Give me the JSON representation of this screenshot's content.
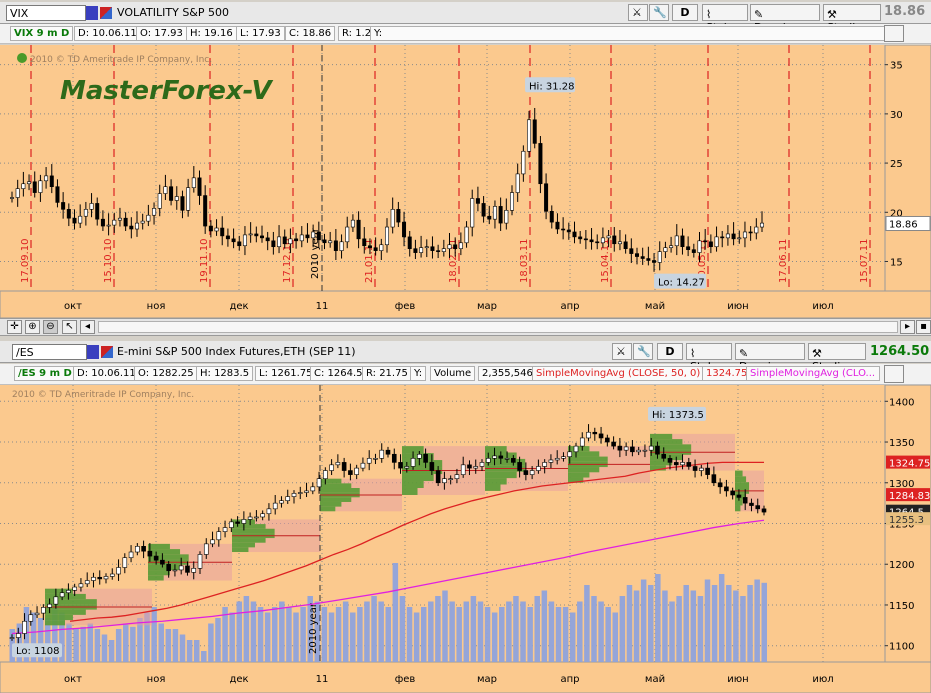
{
  "colors": {
    "bg": "#fbc98e",
    "up": "#000000",
    "grid": "#8a8a8a",
    "vline": "#dd2222",
    "ma50": "#dd2222",
    "ma200": "#e020e0",
    "volume": "#8fa3dc",
    "vp_green": "#4f9a2f",
    "vp_pink": "#e8a0a0",
    "price_last_green": "#0a7a0a"
  },
  "top": {
    "symbol": "VIX",
    "title": "VOLATILITY S&P 500",
    "last": "18.86",
    "buttons": {
      "d": "D",
      "style": "Style",
      "drawings": "Drawings",
      "studies": "Studies"
    },
    "info": {
      "period": "VIX 9 m D",
      "date": "D: 10.06.11",
      "open": "O: 17.93",
      "high": "H: 19.16",
      "low": "L: 17.93",
      "close": "C: 18.86",
      "range": "R: 1.23",
      "y": "Y:"
    },
    "copyright": "2010 © TD Ameritrade IP Company, Inc.",
    "watermark": "MasterForex-V",
    "hi_label": "Hi: 31.28",
    "lo_label": "Lo: 14.27",
    "date_labels": [
      "17.09.10",
      "15.10.10",
      "19.11.10",
      "17.12.10",
      "21.01.11",
      "18.02.11",
      "18.03.11",
      "15.04.11",
      "20.05.11",
      "17.06.11",
      "15.07.11"
    ],
    "year_label": "2010 year",
    "y_ticks": [
      "35",
      "30",
      "25",
      "20",
      "15"
    ],
    "last_label": "18.86"
  },
  "bottom": {
    "symbol": "/ES",
    "title": "E-mini S&P 500 Index Futures,ETH (SEP 11)",
    "last": "1264.50",
    "buttons": {
      "d": "D",
      "style": "Style",
      "drawings": "Drawings",
      "studies": "Studies"
    },
    "info": {
      "period": "/ES 9 m D",
      "date": "D: 10.06.11",
      "open": "O: 1282.25",
      "high": "H: 1283.5",
      "low": "L: 1261.75",
      "close": "C: 1264.5",
      "range": "R: 21.75",
      "y": "Y:",
      "volume_label": "Volume",
      "volume": "2,355,546",
      "sma50_label": "SimpleMovingAvg (CLOSE, 50, 0)",
      "sma50_value": "1324.75",
      "sma200_label": "SimpleMovingAvg (CLO..."
    },
    "copyright": "2010 © TD Ameritrade IP Company, Inc.",
    "hi_label": "Hi: 1373.5",
    "lo_label": "Lo: 1108",
    "year_label": "2010 year",
    "y_ticks": [
      "1400",
      "1350",
      "1300",
      "1250",
      "1200",
      "1150",
      "1100"
    ],
    "price_tags": [
      "1324.75",
      "1284.83",
      "1264.5",
      "1255.3"
    ]
  },
  "months": [
    "окт",
    "ноя",
    "дек",
    "11",
    "фев",
    "мар",
    "апр",
    "май",
    "июн",
    "июл"
  ],
  "chart_data": [
    {
      "type": "line",
      "title": "VOLATILITY S&P 500",
      "ylim": [
        12,
        37
      ],
      "grid": true,
      "series": [
        {
          "name": "VIX",
          "values": [
            21.5,
            22.4,
            22.9,
            23.1,
            22.0,
            23.2,
            23.7,
            22.6,
            21.0,
            20.3,
            19.4,
            18.9,
            19.6,
            20.3,
            20.9,
            19.3,
            18.6,
            18.7,
            19.2,
            19.4,
            18.6,
            18.3,
            18.9,
            19.1,
            19.7,
            20.4,
            21.9,
            22.6,
            21.2,
            21.6,
            20.2,
            22.5,
            23.5,
            21.7,
            18.6,
            18.1,
            18.4,
            17.6,
            17.3,
            17.0,
            16.6,
            17.7,
            17.8,
            17.6,
            17.4,
            17.1,
            16.5,
            17.5,
            16.8,
            17.3,
            17.1,
            17.7,
            17.4,
            18.0,
            17.2,
            16.9,
            17.1,
            16.1,
            17.0,
            18.5,
            19.2,
            17.3,
            16.6,
            16.4,
            16.1,
            16.7,
            18.5,
            20.3,
            19.0,
            17.5,
            16.3,
            15.9,
            16.4,
            16.5,
            16.1,
            16.0,
            16.3,
            16.7,
            16.3,
            16.9,
            18.5,
            21.4,
            20.9,
            19.6,
            19.3,
            20.6,
            18.9,
            20.2,
            22.0,
            23.9,
            26.2,
            29.4,
            27.0,
            22.9,
            20.1,
            19.0,
            18.3,
            18.2,
            18.0,
            17.5,
            17.3,
            17.2,
            17.0,
            16.9,
            17.4,
            17.6,
            16.8,
            17.0,
            16.3,
            15.8,
            15.5,
            15.3,
            15.1,
            14.9,
            16.0,
            16.4,
            16.6,
            17.6,
            16.5,
            16.2,
            15.9,
            17.1,
            17.0,
            16.5,
            17.5,
            17.4,
            17.8,
            17.3,
            17.4,
            18.0,
            17.9,
            18.5,
            18.9
          ]
        }
      ]
    },
    {
      "type": "line",
      "title": "E-mini S&P 500 Index Futures,ETH (SEP 11)",
      "ylim": [
        1080,
        1420
      ],
      "grid": true,
      "series": [
        {
          "name": "/ES",
          "values": [
            1110,
            1115,
            1130,
            1138,
            1140,
            1147,
            1151,
            1160,
            1165,
            1168,
            1172,
            1176,
            1180,
            1184,
            1182,
            1185,
            1188,
            1196,
            1208,
            1215,
            1222,
            1216,
            1210,
            1205,
            1200,
            1192,
            1193,
            1198,
            1190,
            1195,
            1212,
            1225,
            1230,
            1240,
            1245,
            1252,
            1250,
            1255,
            1258,
            1258,
            1262,
            1268,
            1275,
            1278,
            1283,
            1287,
            1288,
            1290,
            1295,
            1305,
            1315,
            1322,
            1325,
            1315,
            1310,
            1318,
            1324,
            1330,
            1330,
            1340,
            1335,
            1325,
            1318,
            1320,
            1330,
            1335,
            1325,
            1315,
            1300,
            1305,
            1305,
            1310,
            1322,
            1318,
            1320,
            1325,
            1330,
            1333,
            1330,
            1330,
            1325,
            1315,
            1310,
            1315,
            1320,
            1325,
            1328,
            1330,
            1332,
            1338,
            1345,
            1355,
            1362,
            1360,
            1355,
            1350,
            1345,
            1340,
            1344,
            1338,
            1340,
            1340,
            1345,
            1335,
            1330,
            1325,
            1322,
            1325,
            1320,
            1315,
            1318,
            1310,
            1300,
            1295,
            1290,
            1285,
            1282,
            1275,
            1272,
            1268,
            1264
          ]
        },
        {
          "name": "SimpleMovingAvg (CLOSE, 50, 0)",
          "values": [
            1130,
            1132,
            1134,
            1135,
            1137,
            1140,
            1143,
            1146,
            1150,
            1155,
            1160,
            1165,
            1170,
            1175,
            1180,
            1186,
            1192,
            1198,
            1205,
            1212,
            1218,
            1225,
            1233,
            1240,
            1248,
            1255,
            1262,
            1268,
            1273,
            1278,
            1282,
            1286,
            1290,
            1293,
            1296,
            1298,
            1300,
            1302,
            1304,
            1306,
            1308,
            1312,
            1315,
            1318,
            1320,
            1322,
            1324,
            1325,
            1325,
            1325,
            1325
          ]
        },
        {
          "name": "SimpleMovingAvg (CLO...",
          "values": [
            1115,
            1117,
            1120,
            1122,
            1125,
            1128,
            1130,
            1133,
            1136,
            1140,
            1143,
            1147,
            1151,
            1156,
            1161,
            1166,
            1172,
            1178,
            1184,
            1190,
            1196,
            1202,
            1208,
            1215,
            1221,
            1227,
            1233,
            1239,
            1245,
            1250,
            1254
          ]
        },
        {
          "name": "Volume",
          "values": [
            0.3,
            0.35,
            0.5,
            0.45,
            0.4,
            0.4,
            0.5,
            0.45,
            0.35,
            0.3,
            0.32,
            0.35,
            0.3,
            0.25,
            0.2,
            0.3,
            0.35,
            0.32,
            0.4,
            0.45,
            0.5,
            0.35,
            0.3,
            0.3,
            0.25,
            0.2,
            0.2,
            0.1,
            0.35,
            0.4,
            0.5,
            0.45,
            0.55,
            0.6,
            0.55,
            0.5,
            0.45,
            0.5,
            0.55,
            0.5,
            0.45,
            0.5,
            0.6,
            0.55,
            0.5,
            0.45,
            0.5,
            0.55,
            0.45,
            0.5,
            0.55,
            0.6,
            0.55,
            0.5,
            0.9,
            0.6,
            0.5,
            0.45,
            0.5,
            0.55,
            0.6,
            0.65,
            0.55,
            0.5,
            0.55,
            0.6,
            0.55,
            0.5,
            0.45,
            0.5,
            0.55,
            0.6,
            0.55,
            0.5,
            0.6,
            0.65,
            0.55,
            0.5,
            0.5,
            0.45,
            0.55,
            0.7,
            0.6,
            0.55,
            0.5,
            0.45,
            0.6,
            0.7,
            0.65,
            0.75,
            0.7,
            0.8,
            0.65,
            0.55,
            0.6,
            0.7,
            0.65,
            0.6,
            0.75,
            0.7,
            0.8,
            0.7,
            0.65,
            0.6,
            0.7,
            0.75,
            0.72
          ]
        }
      ]
    }
  ]
}
